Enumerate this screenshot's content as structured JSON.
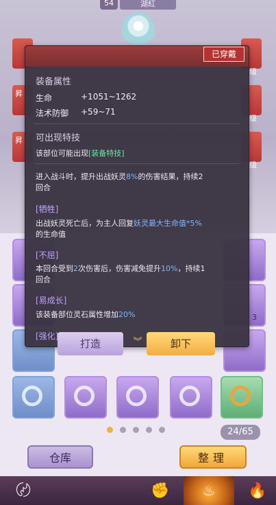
{
  "header": {
    "level": "54",
    "player_name": "湖紅"
  },
  "slots": {
    "left_tag_1": "昇",
    "left_tag_2": "昇",
    "right_tag_1": "级",
    "right_tag_2": "级",
    "right_tag_3": "级"
  },
  "popup": {
    "equipped_badge": "已穿戴",
    "section_attributes": "装备属性",
    "stat_hp_label": "生命",
    "stat_hp_value": "+1051~1262",
    "stat_mdef_label": "法术防御",
    "stat_mdef_value": "+59~71",
    "section_skills": "可出现特技",
    "skills_intro_prefix": "该部位可能出现",
    "skills_intro_link": "[装备特技]",
    "skill1_text_a": "进入战斗时，提升出战妖灵",
    "skill1_pct": "8%",
    "skill1_text_b": "的伤害结果，持续2",
    "skill1_text_c": "回合",
    "skill2_title": "[牺牲]",
    "skill2_text_a": "出战妖灵死亡后，为主人回复",
    "skill2_highlight": "妖灵最大生命值*5%",
    "skill2_text_b": "的生命值",
    "skill3_title": "[不屈]",
    "skill3_text_a": "本回合受到",
    "skill3_num": "2",
    "skill3_text_b": "次伤害后，伤害减免提升",
    "skill3_pct": "10%",
    "skill3_text_c": "，持续1",
    "skill3_text_d": "回合",
    "skill4_title": "[易成长]",
    "skill4_text_a": "该装备部位灵石属性增加",
    "skill4_pct": "20%",
    "skill5_title": "[强化]"
  },
  "actions": {
    "forge": "打造",
    "remove": "卸下"
  },
  "pager": {
    "count": "24/65"
  },
  "buttons": {
    "warehouse": "仓库",
    "arrange": "整理"
  },
  "grid_badge": "3",
  "colors": {
    "accent_gold": "#f0b23a",
    "panel": "#3a3442",
    "highlight_green": "#6fe3a9",
    "highlight_purple": "#c3a0ff"
  }
}
